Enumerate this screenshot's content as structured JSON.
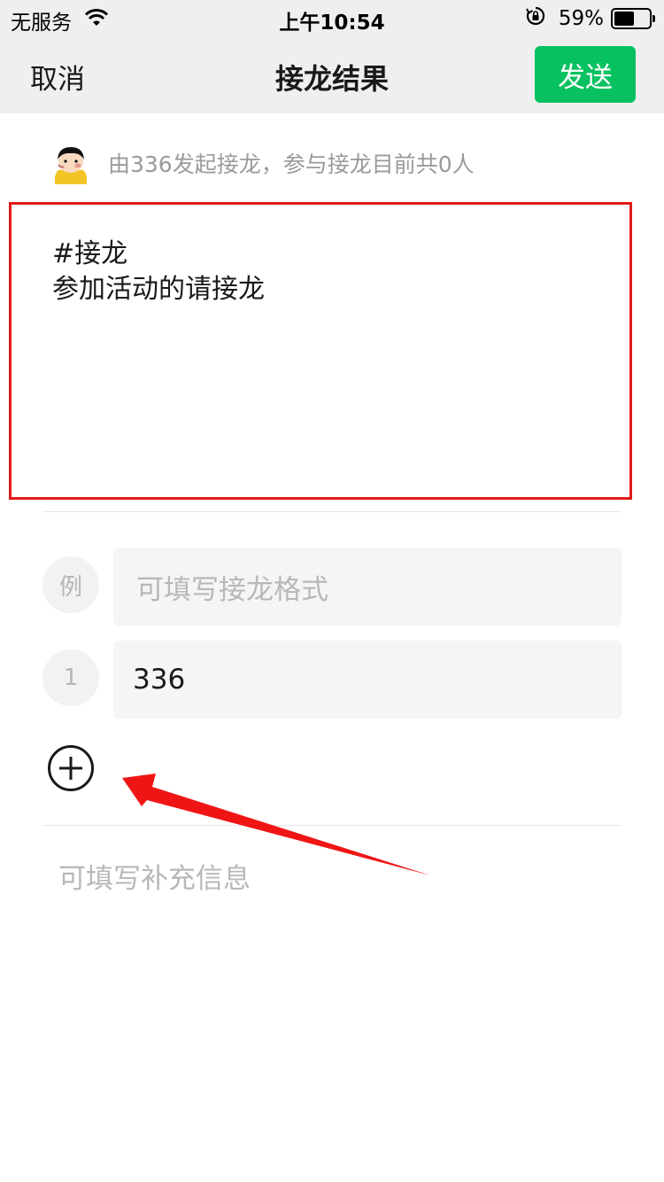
{
  "status_bar": {
    "carrier": "无服务",
    "time": "上午10:54",
    "battery_percent": "59%",
    "battery_level": 0.59
  },
  "nav": {
    "cancel": "取消",
    "title": "接龙结果",
    "send": "发送"
  },
  "initiator": {
    "text": "由336发起接龙，参与接龙目前共0人"
  },
  "topic": {
    "line1": "#接龙",
    "line2": "参加活动的请接龙"
  },
  "example_row": {
    "index": "例",
    "placeholder": "可填写接龙格式"
  },
  "entries": [
    {
      "index": "1",
      "value": "336"
    }
  ],
  "supplement": {
    "placeholder": "可填写补充信息"
  },
  "colors": {
    "send_button": "#07c160",
    "highlight_box": "#e21a1a",
    "annotation_arrow": "#f01515"
  },
  "icons": {
    "add": "plus-circle-icon",
    "wifi": "wifi-icon",
    "orientation_lock": "orientation-lock-icon",
    "battery": "battery-icon"
  }
}
